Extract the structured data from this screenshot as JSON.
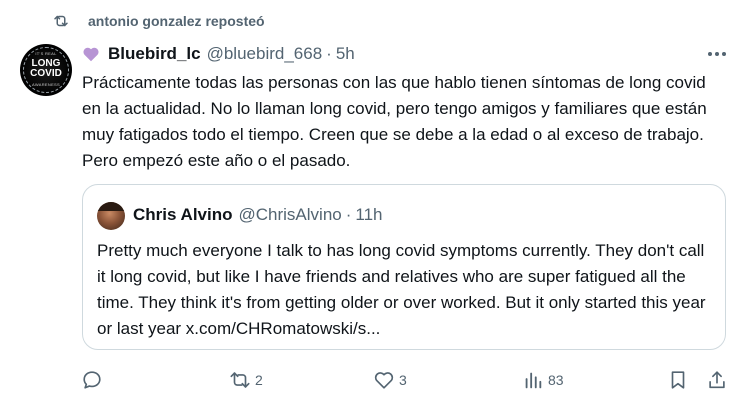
{
  "repost": {
    "text": "antonio gonzalez reposteó",
    "icon": "repost-icon"
  },
  "tweet": {
    "avatar": {
      "top_text": "IT'S REAL",
      "line1": "LONG",
      "line2": "COVID",
      "bottom_text": "AWARENESS"
    },
    "badge_color": "#b794d4",
    "author_name": "Bluebird_lc",
    "handle": "@bluebird_668",
    "separator": "·",
    "time": "5h",
    "text": "Prácticamente todas las personas con las que hablo tienen síntomas de long covid en la actualidad. No lo llaman long covid, pero tengo amigos y familiares que están muy fatigados todo el tiempo. Creen que se debe a la edad o al exceso de trabajo. Pero empezó este año o el pasado."
  },
  "quoted": {
    "author_name": "Chris Alvino",
    "handle": "@ChrisAlvino",
    "separator": "·",
    "time": "11h",
    "text": "Pretty much everyone I talk to has long covid symptoms currently. They don't call it long covid, but like I have friends and relatives who are super fatigued all the time. They think it's from getting older or over worked. But it only started this year or last year x.com/CHRomatowski/s..."
  },
  "actions": {
    "reply_count": "",
    "repost_count": "2",
    "like_count": "3",
    "views_count": "83"
  },
  "colors": {
    "text": "#0f1419",
    "muted": "#536471",
    "border": "#cfd9de"
  }
}
